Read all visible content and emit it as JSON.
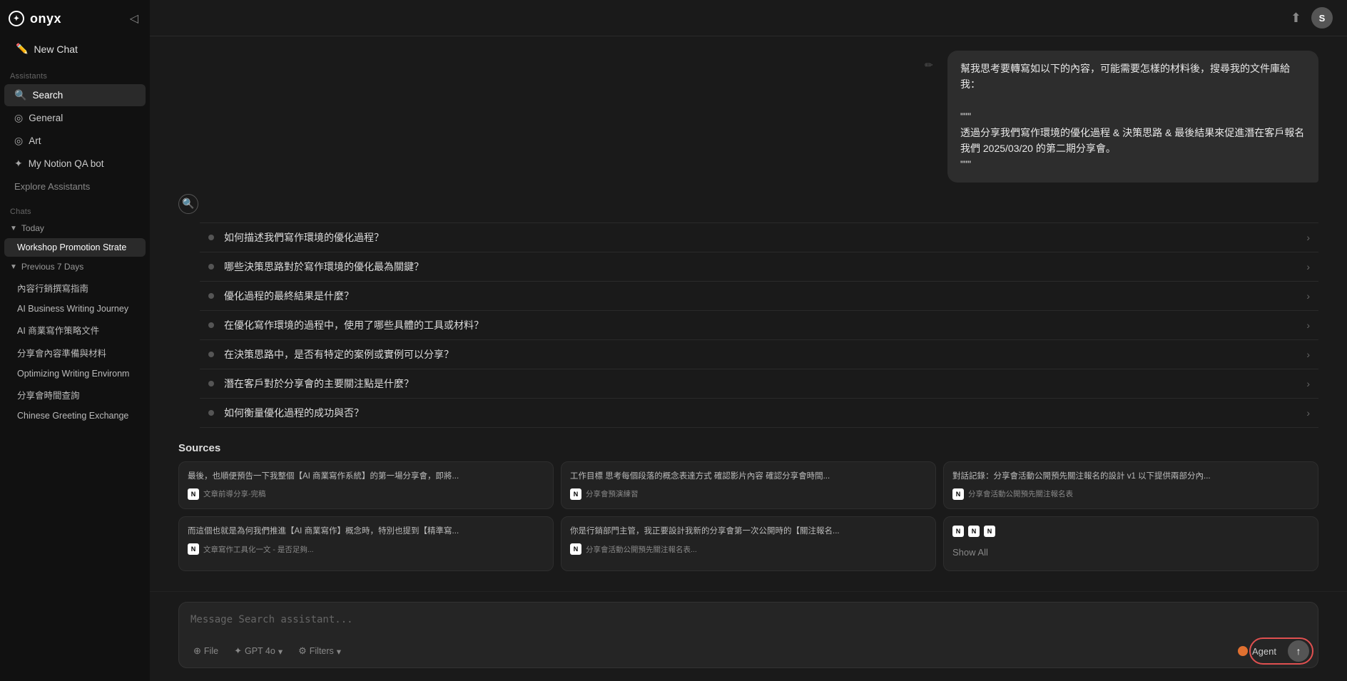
{
  "sidebar": {
    "logo": "onyx",
    "new_chat_label": "New Chat",
    "assistants_label": "Assistants",
    "assistants": [
      {
        "id": "search",
        "icon": "🔍",
        "label": "Search",
        "active": true
      },
      {
        "id": "general",
        "icon": "◎",
        "label": "General",
        "active": false
      },
      {
        "id": "art",
        "icon": "◎",
        "label": "Art",
        "active": false
      },
      {
        "id": "notion-qa",
        "icon": "✦",
        "label": "My Notion QA bot",
        "active": false
      }
    ],
    "explore_label": "Explore Assistants",
    "chats_label": "Chats",
    "today_label": "Today",
    "today_chats": [
      {
        "id": "workshop",
        "label": "Workshop Promotion Strate",
        "active": true
      }
    ],
    "previous_label": "Previous 7 Days",
    "previous_chats": [
      {
        "id": "content-marketing",
        "label": "內容行銷撰寫指南"
      },
      {
        "id": "ai-business-writing",
        "label": "AI Business Writing Journey"
      },
      {
        "id": "ai-commercial",
        "label": "AI 商業寫作策略文件"
      },
      {
        "id": "sharing-prep",
        "label": "分享會內容準備與材料"
      },
      {
        "id": "optimizing-writing",
        "label": "Optimizing Writing Environm"
      },
      {
        "id": "sharing-time",
        "label": "分享會時間查詢"
      },
      {
        "id": "chinese-greeting",
        "label": "Chinese Greeting Exchange"
      }
    ]
  },
  "topbar": {
    "share_icon": "⬆",
    "avatar_letter": "S"
  },
  "chat": {
    "user_message": {
      "line1": "幫我思考要轉寫如以下的內容，可能需要怎樣的材料後，搜尋我的文件庫給我：",
      "line2": "\"\"\"",
      "line3": "透過分享我們寫作環境的優化過程 & 決策思路 & 最後結果來促進潛在客戶報名我們 2025/03/20 的第二期分享會。",
      "line4": "\"\"\""
    },
    "search_indicator": "🔍",
    "questions": [
      {
        "id": "q1",
        "text": "如何描述我們寫作環境的優化過程？"
      },
      {
        "id": "q2",
        "text": "哪些決策思路對於寫作環境的優化最為關鍵？"
      },
      {
        "id": "q3",
        "text": "優化過程的最終結果是什麼？"
      },
      {
        "id": "q4",
        "text": "在優化寫作環境的過程中，使用了哪些具體的工具或材料？"
      },
      {
        "id": "q5",
        "text": "在決策思路中，是否有特定的案例或實例可以分享？"
      },
      {
        "id": "q6",
        "text": "潛在客戶對於分享會的主要關注點是什麼？"
      },
      {
        "id": "q7",
        "text": "如何衡量優化過程的成功與否？"
      }
    ],
    "sources_label": "Sources",
    "sources": [
      {
        "id": "src1",
        "text": "最後，也順便預告一下我整個【AI 商業寫作系統】的第一場分享會，即將...",
        "file": "文章前導分享-完稿"
      },
      {
        "id": "src2",
        "text": "工作目標 思考每個段落的概念表達方式 確認影片內容 確認分享會時間...",
        "file": "分享會預演練習"
      },
      {
        "id": "src3",
        "text": "對話記錄：分享會活動公開預先關注報名的設計 v1 以下提供兩部分內...",
        "file": "分享會活動公開預先關注報名表"
      },
      {
        "id": "src4",
        "text": "而這個也就是為何我們推進【AI 商業寫作】概念時，特別也提到【精準寫...",
        "file": "文章寫作工具化一文 - 是否足夠..."
      },
      {
        "id": "src5",
        "text": "你是行銷部門主管，我正要設計我新的分享會第一次公開時的【關注報名...",
        "file": "分享會活動公開預先關注報名表..."
      },
      {
        "id": "src6",
        "text": "",
        "file": "",
        "multi_icon": true
      }
    ],
    "show_all_label": "Show All"
  },
  "input": {
    "placeholder": "Message Search assistant...",
    "file_label": "File",
    "model_label": "GPT 4o",
    "filters_label": "Filters",
    "agent_label": "Agent",
    "send_icon": "↑"
  }
}
